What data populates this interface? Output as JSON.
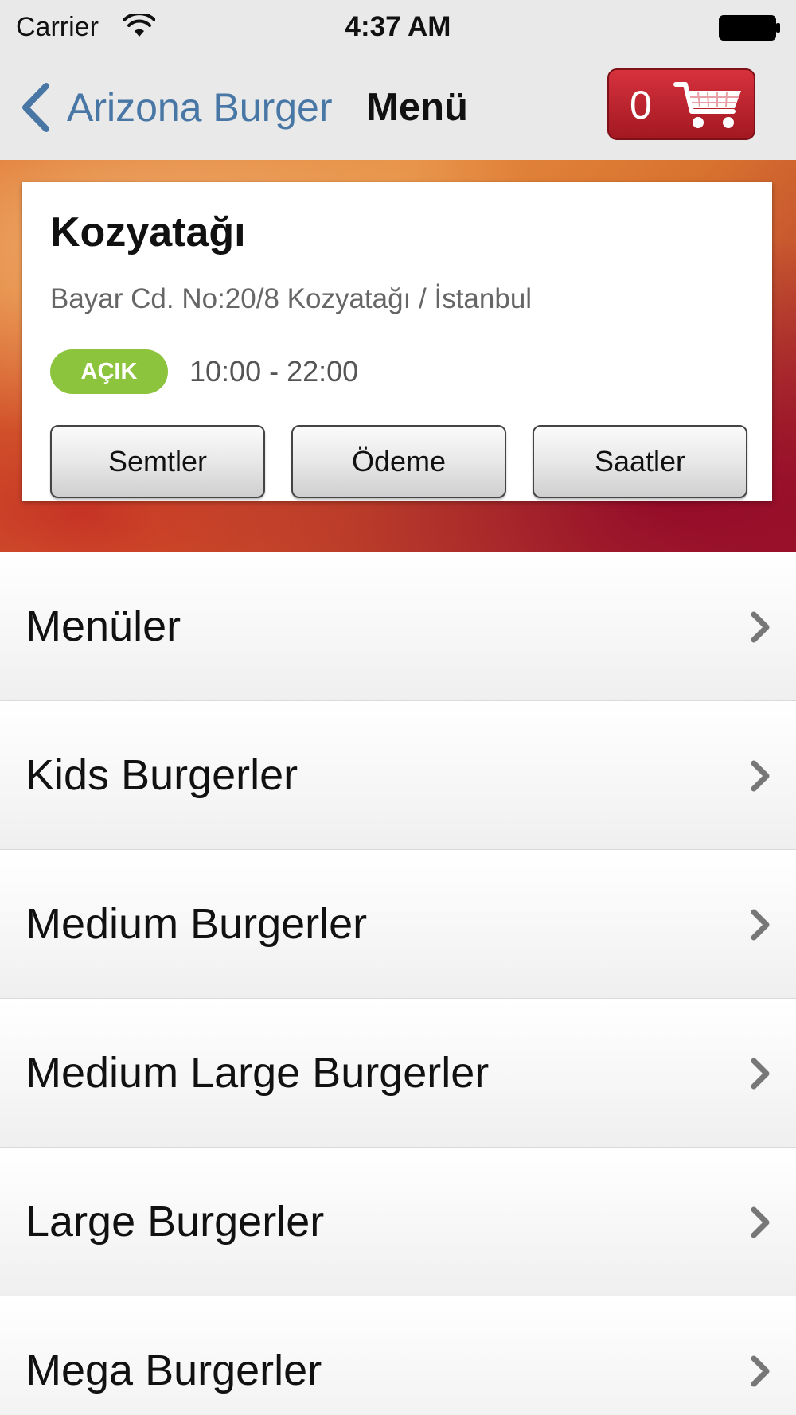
{
  "status_bar": {
    "carrier": "Carrier",
    "time": "4:37 AM",
    "icons": [
      "wifi-icon",
      "battery-icon"
    ]
  },
  "nav": {
    "back_label": "Arizona Burger",
    "title": "Menü",
    "cart_count": "0",
    "icons": [
      "chevron-left-icon",
      "shopping-cart-icon"
    ]
  },
  "store": {
    "name": "Kozyatağı",
    "address": "Bayar Cd. No:20/8 Kozyatağı / İstanbul",
    "status": "AÇIK",
    "hours": "10:00 - 22:00",
    "buttons": [
      "Semtler",
      "Ödeme",
      "Saatler"
    ]
  },
  "menu": {
    "items": [
      "Menüler",
      "Kids Burgerler",
      "Medium Burgerler",
      "Medium Large Burgerler",
      "Large Burgerler",
      "Mega Burgerler"
    ]
  },
  "colors": {
    "accent_blue": "#4877a5",
    "cart_red": "#c0232d",
    "open_green": "#8cc43d",
    "bar_gray": "#e9e9e9"
  }
}
